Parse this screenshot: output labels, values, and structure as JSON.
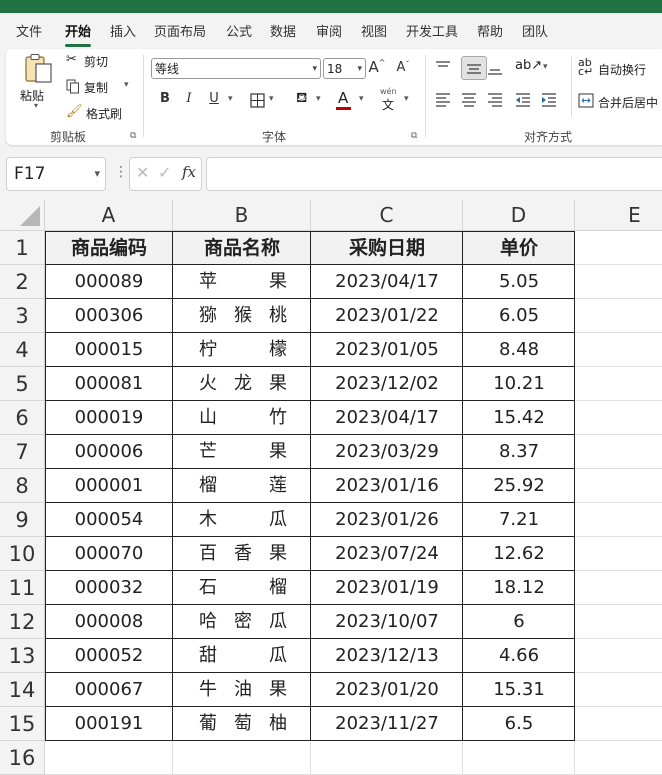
{
  "menu": {
    "items": [
      "文件",
      "开始",
      "插入",
      "页面布局",
      "公式",
      "数据",
      "审阅",
      "视图",
      "开发工具",
      "帮助",
      "团队"
    ],
    "active_index": 1
  },
  "ribbon": {
    "clipboard": {
      "paste_label": "粘贴",
      "cut_label": "剪切",
      "copy_label": "复制",
      "format_painter_label": "格式刷",
      "group_label": "剪贴板"
    },
    "font": {
      "font_name": "等线",
      "font_size": "18",
      "bold": "B",
      "italic": "I",
      "underline": "U",
      "font_color_letter": "A",
      "phonetic_label": "wén",
      "phonetic_char": "文",
      "grow_font": "A",
      "shrink_font": "A",
      "group_label": "字体"
    },
    "alignment": {
      "wrap_text_label": "自动换行",
      "merge_center_label": "合并后居中",
      "group_label": "对齐方式"
    },
    "colors": {
      "accent": "#217346",
      "font_color_bar": "#c00000"
    }
  },
  "formula_bar": {
    "name_box": "F17",
    "fx_label": "fx",
    "formula": ""
  },
  "sheet": {
    "columns": [
      "A",
      "B",
      "C",
      "D",
      "E"
    ],
    "rows": [
      "1",
      "2",
      "3",
      "4",
      "5",
      "6",
      "7",
      "8",
      "9",
      "10",
      "11",
      "12",
      "13",
      "14",
      "15",
      "16"
    ],
    "table_headers": [
      "商品编码",
      "商品名称",
      "采购日期",
      "单价"
    ],
    "data_rows": [
      {
        "code": "000089",
        "name": [
          "苹",
          "果"
        ],
        "date": "2023/04/17",
        "price": "5.05"
      },
      {
        "code": "000306",
        "name": [
          "猕",
          "猴",
          "桃"
        ],
        "date": "2023/01/22",
        "price": "6.05"
      },
      {
        "code": "000015",
        "name": [
          "柠",
          "檬"
        ],
        "date": "2023/01/05",
        "price": "8.48"
      },
      {
        "code": "000081",
        "name": [
          "火",
          "龙",
          "果"
        ],
        "date": "2023/12/02",
        "price": "10.21"
      },
      {
        "code": "000019",
        "name": [
          "山",
          "竹"
        ],
        "date": "2023/04/17",
        "price": "15.42"
      },
      {
        "code": "000006",
        "name": [
          "芒",
          "果"
        ],
        "date": "2023/03/29",
        "price": "8.37"
      },
      {
        "code": "000001",
        "name": [
          "榴",
          "莲"
        ],
        "date": "2023/01/16",
        "price": "25.92"
      },
      {
        "code": "000054",
        "name": [
          "木",
          "瓜"
        ],
        "date": "2023/01/26",
        "price": "7.21"
      },
      {
        "code": "000070",
        "name": [
          "百",
          "香",
          "果"
        ],
        "date": "2023/07/24",
        "price": "12.62"
      },
      {
        "code": "000032",
        "name": [
          "石",
          "榴"
        ],
        "date": "2023/01/19",
        "price": "18.12"
      },
      {
        "code": "000008",
        "name": [
          "哈",
          "密",
          "瓜"
        ],
        "date": "2023/10/07",
        "price": "6"
      },
      {
        "code": "000052",
        "name": [
          "甜",
          "瓜"
        ],
        "date": "2023/12/13",
        "price": "4.66"
      },
      {
        "code": "000067",
        "name": [
          "牛",
          "油",
          "果"
        ],
        "date": "2023/01/20",
        "price": "15.31"
      },
      {
        "code": "000191",
        "name": [
          "葡",
          "萄",
          "柚"
        ],
        "date": "2023/11/27",
        "price": "6.5"
      }
    ]
  }
}
